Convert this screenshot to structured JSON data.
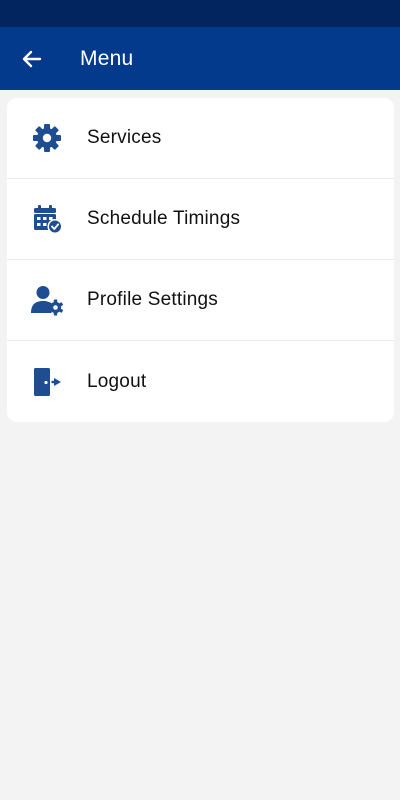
{
  "colors": {
    "status_bar": "#02255f",
    "app_bar": "#033a8c",
    "icon": "#1f4d92",
    "background": "#f3f3f3"
  },
  "header": {
    "back_icon": "arrow-left-icon",
    "title": "Menu"
  },
  "menu": {
    "items": [
      {
        "label": "Services",
        "icon": "gear-icon"
      },
      {
        "label": "Schedule Timings",
        "icon": "calendar-check-icon"
      },
      {
        "label": "Profile Settings",
        "icon": "user-gear-icon"
      },
      {
        "label": "Logout",
        "icon": "logout-door-icon"
      }
    ]
  }
}
